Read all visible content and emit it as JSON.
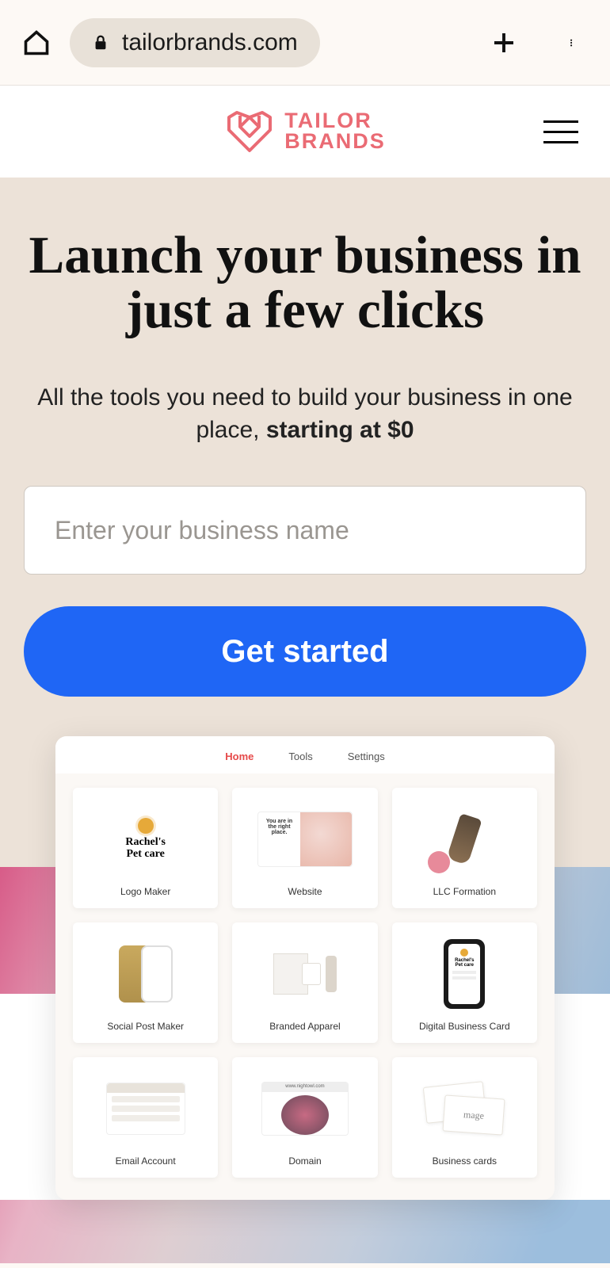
{
  "browser": {
    "url": "tailorbrands.com"
  },
  "logo": {
    "line1": "TAILOR",
    "line2": "BRANDS"
  },
  "hero": {
    "title": "Launch your business in just a few clicks",
    "subtitle_plain": "All the tools you need to build your business in one place, ",
    "subtitle_bold": "starting at $0",
    "input_placeholder": "Enter your business name",
    "cta_label": "Get started"
  },
  "dashboard": {
    "tabs": [
      "Home",
      "Tools",
      "Settings"
    ],
    "active_tab": "Home",
    "tiles": [
      {
        "label": "Logo Maker",
        "brand_line1": "Rachel's",
        "brand_line2": "Pet care"
      },
      {
        "label": "Website",
        "teaser": "You are in the right place."
      },
      {
        "label": "LLC Formation"
      },
      {
        "label": "Social Post Maker"
      },
      {
        "label": "Branded Apparel"
      },
      {
        "label": "Digital Business Card",
        "brand_line1": "Rachel's",
        "brand_line2": "Pet care"
      },
      {
        "label": "Email Account"
      },
      {
        "label": "Domain",
        "url_sample": "www.nightowl.com"
      },
      {
        "label": "Business cards",
        "script": "mage"
      }
    ]
  }
}
